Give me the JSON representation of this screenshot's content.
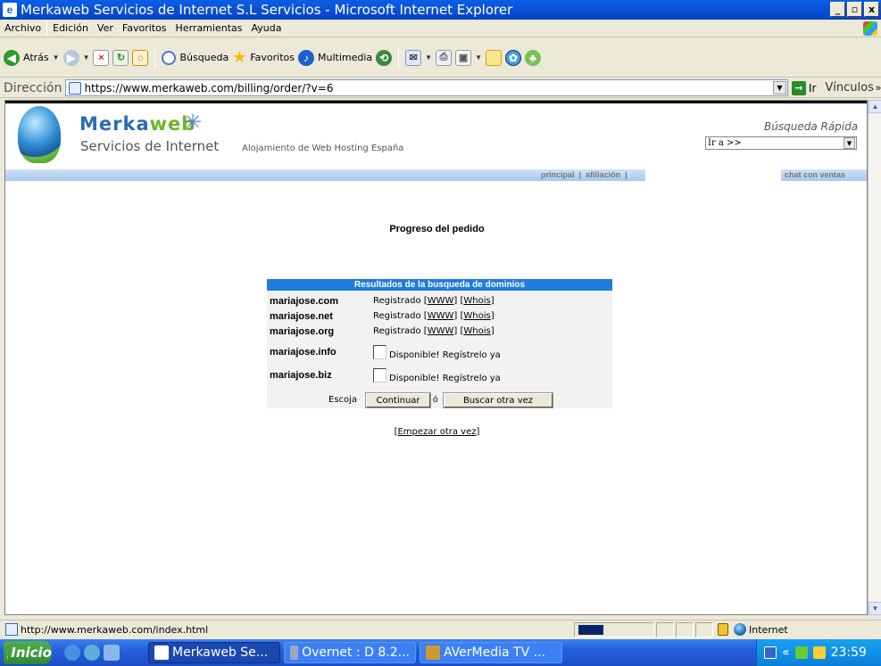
{
  "window": {
    "title": "Merkaweb Servicios de Internet S.L Servicios - Microsoft Internet Explorer",
    "minimize": "_",
    "maximize": "▫",
    "close": "x"
  },
  "menu": [
    "Archivo",
    "Edición",
    "Ver",
    "Favoritos",
    "Herramientas",
    "Ayuda"
  ],
  "toolbar": {
    "back_label": "Atrás",
    "search_label": "Búsqueda",
    "favorites_label": "Favoritos",
    "multimedia_label": "Multimedia"
  },
  "address": {
    "label": "Dirección",
    "url": "https://www.merkaweb.com/billing/order/?v=6",
    "go_label": "Ir",
    "links_label": "Vínculos"
  },
  "page": {
    "brand_main": "Merka",
    "brand_accent": "web",
    "brand_sub": "Servicios de Internet",
    "tagline": "Alojamiento de Web Hosting España",
    "quick_search_label": "Búsqueda Rápida",
    "quick_search_value": "Ir a >>",
    "nav_principal": "principal",
    "nav_afiliacion": "afiliación",
    "nav_sep": "|",
    "nav_chat": "chat con ventas",
    "progress_title": "Progreso del pedido",
    "results": {
      "header": "Resultados de la busqueda de dominios",
      "registered": [
        {
          "domain": "mariajose.com",
          "status": "Registrado",
          "www": "WWW",
          "whois": "Whois"
        },
        {
          "domain": "mariajose.net",
          "status": "Registrado",
          "www": "WWW",
          "whois": "Whois"
        },
        {
          "domain": "mariajose.org",
          "status": "Registrado",
          "www": "WWW",
          "whois": "Whois"
        }
      ],
      "available": [
        {
          "domain": "mariajose.info",
          "status": "Disponible! Regístrelo ya"
        },
        {
          "domain": "mariajose.biz",
          "status": "Disponible! Regístrelo ya"
        }
      ],
      "choose_label": "Escoja",
      "continue_button": "Continuar",
      "or_label": "ó",
      "search_again_button": "Buscar otra vez"
    },
    "restart_link": "Empezar otra vez"
  },
  "statusbar": {
    "url": "http://www.merkaweb.com/index.html",
    "zone": "Internet"
  },
  "taskbar": {
    "start": "Inicio",
    "tasks": [
      "Merkaweb Se...",
      "Overnet : D 8.2...",
      "AVerMedia TV ..."
    ],
    "clock": "23:59",
    "tray_chevron": "«"
  }
}
